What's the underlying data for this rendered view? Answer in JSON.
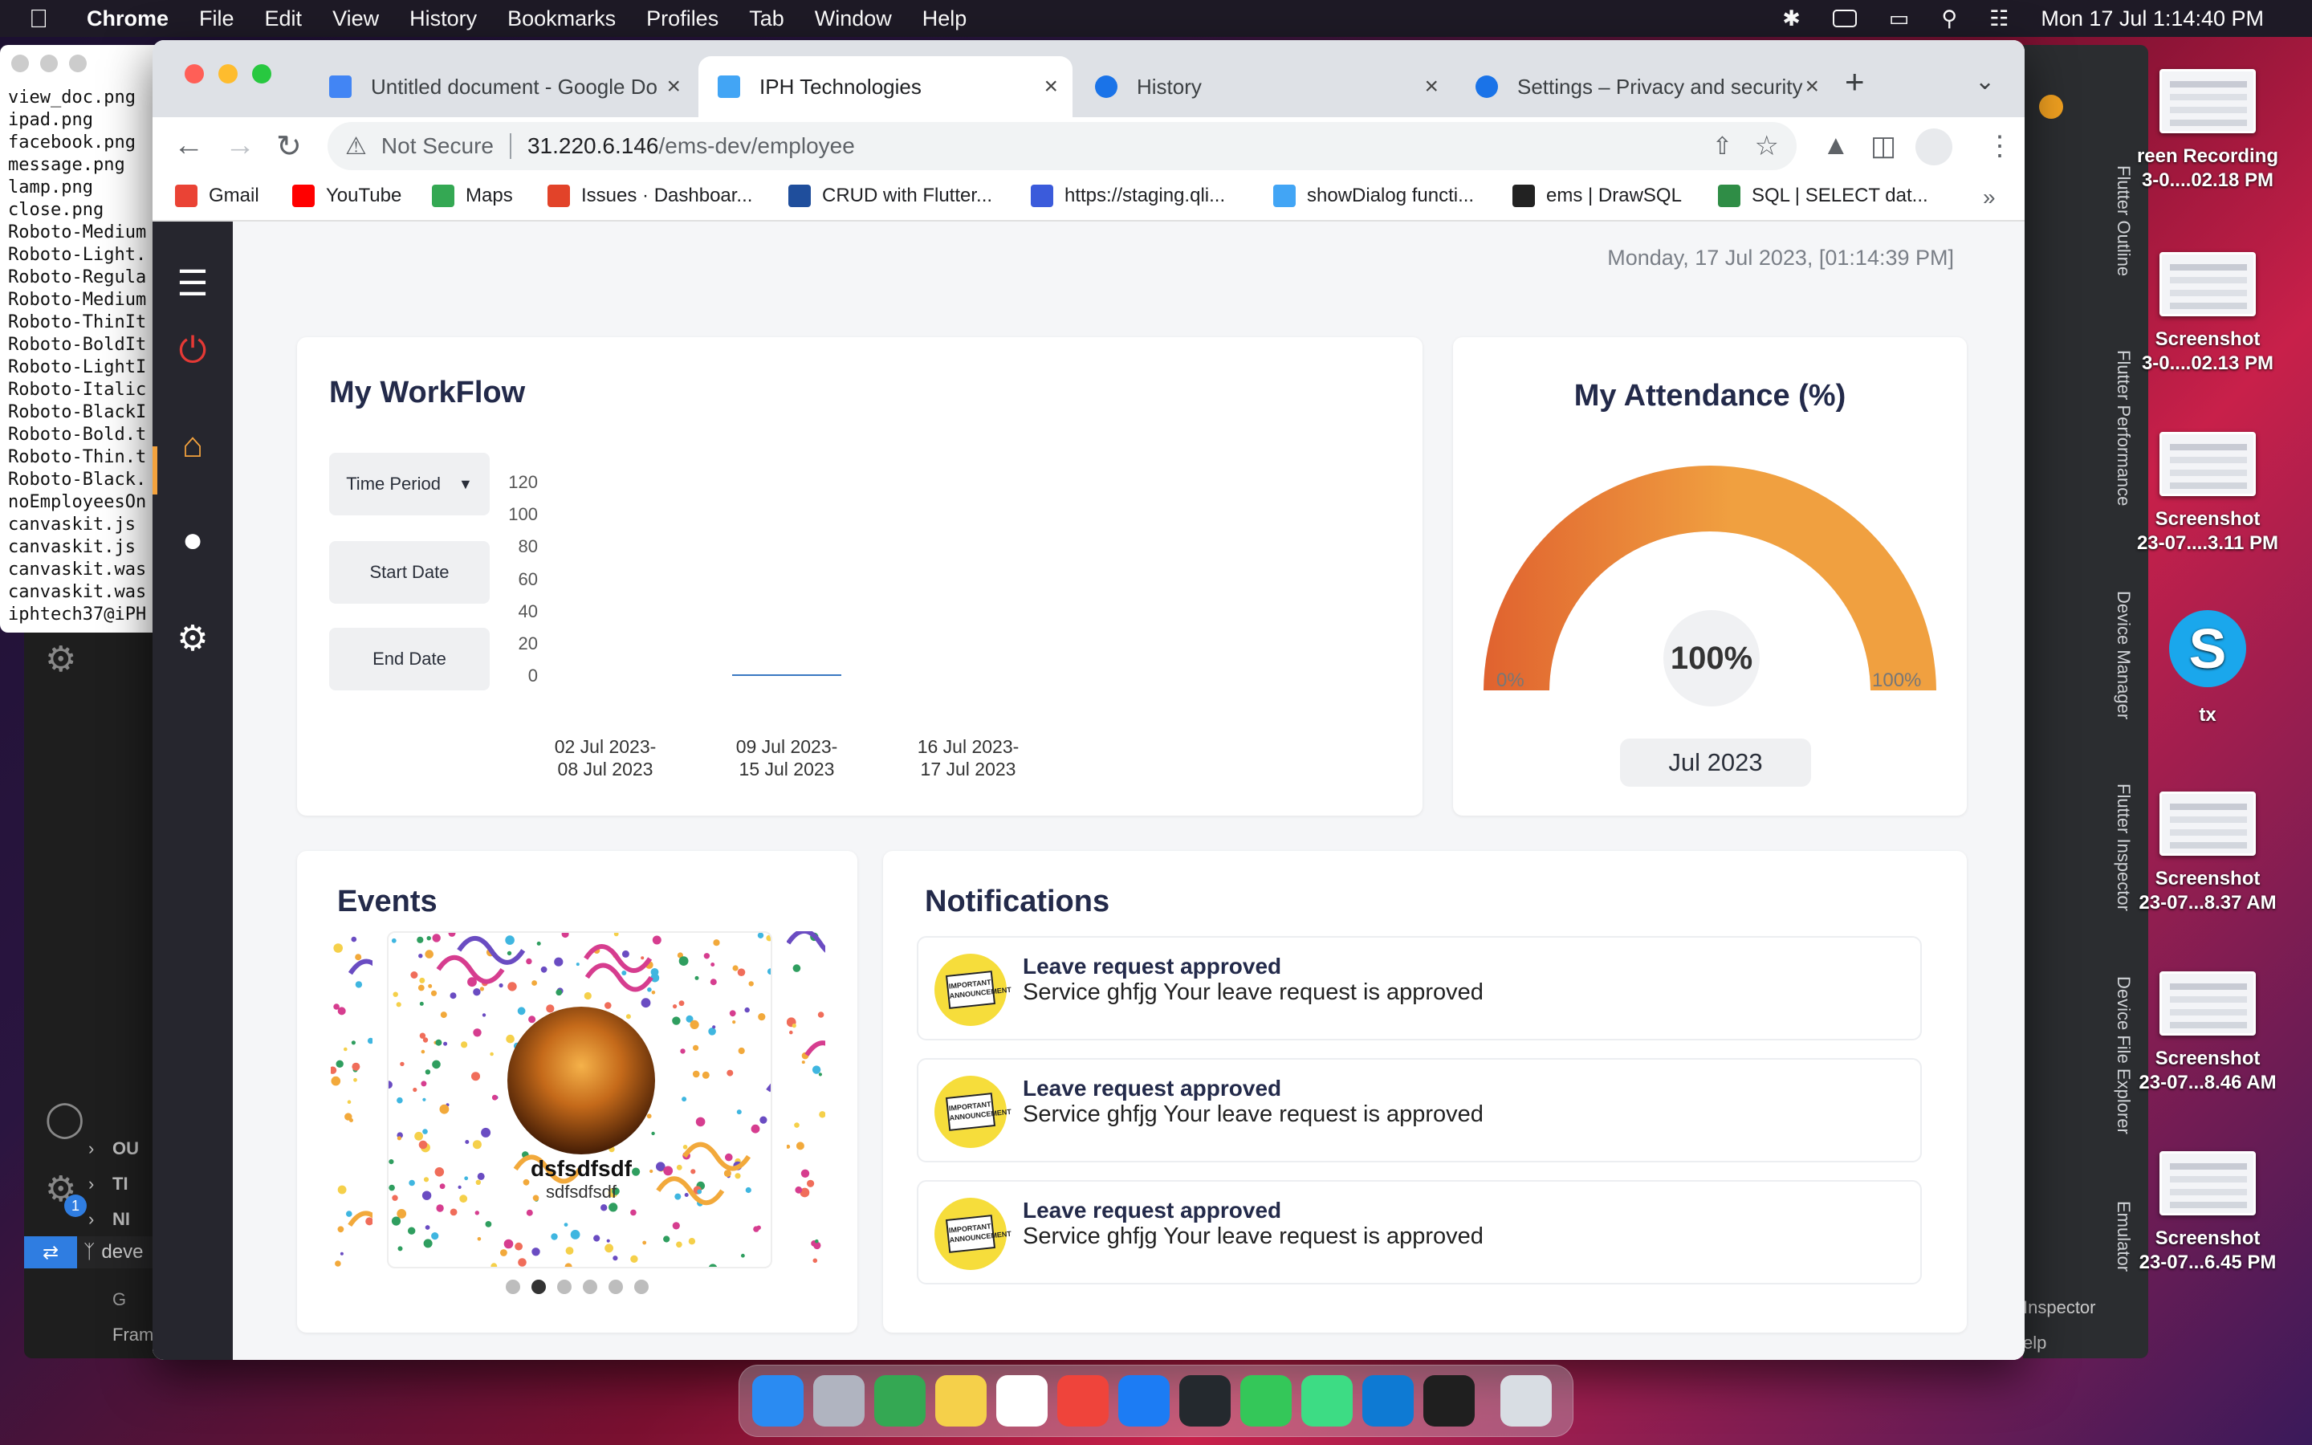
{
  "menubar": {
    "app": "Chrome",
    "items": [
      "File",
      "Edit",
      "View",
      "History",
      "Bookmarks",
      "Profiles",
      "Tab",
      "Window",
      "Help"
    ],
    "clock": "Mon 17 Jul  1:14:40 PM"
  },
  "finder_files": [
    "view_doc.png",
    "ipad.png",
    "facebook.png",
    "message.png",
    "lamp.png",
    "close.png",
    "Roboto-Medium",
    "Roboto-Light.",
    "Roboto-Regula",
    "Roboto-Medium",
    "Roboto-ThinIt",
    "Roboto-BoldIt",
    "Roboto-LightI",
    "Roboto-Italic",
    "Roboto-BlackI",
    "Roboto-Bold.t",
    "Roboto-Thin.t",
    "Roboto-Black.",
    "noEmployeesOn",
    "canvaskit.js",
    "canvaskit.js",
    "canvaskit.was",
    "canvaskit.was",
    "iphtech37@iPH"
  ],
  "vscode": {
    "labels": [
      "OU",
      "TI",
      "NI"
    ],
    "branch": "deve",
    "bottom": "Fram",
    "badge": "1",
    "bottom_prefix": "G"
  },
  "ide": {
    "panels": [
      "Flutter Outline",
      "Flutter Performance",
      "Device Manager",
      "Flutter Inspector",
      "Device File Explorer",
      "Emulator"
    ],
    "inspector": "Inspector",
    "help": "elp"
  },
  "desktop": [
    {
      "line1": "reen Recording",
      "line2": "3-0....02.18 PM"
    },
    {
      "line1": "Screenshot",
      "line2": "3-0....02.13 PM"
    },
    {
      "line1": "Screenshot",
      "line2": "23-07....3.11 PM"
    },
    {
      "line1": "tx",
      "line2": ""
    },
    {
      "line1": "Screenshot",
      "line2": "23-07...8.37 AM"
    },
    {
      "line1": "Screenshot",
      "line2": "23-07...8.46 AM"
    },
    {
      "line1": "Screenshot",
      "line2": "23-07...6.45 PM"
    }
  ],
  "skype_letter": "S",
  "tabs": [
    {
      "title": "Untitled document - Google Do",
      "color": "#4285f4"
    },
    {
      "title": "IPH Technologies",
      "color": "#42a5f5"
    },
    {
      "title": "History",
      "color": "#1a73e8"
    },
    {
      "title": "Settings – Privacy and security",
      "color": "#1a73e8"
    }
  ],
  "omnibox": {
    "security": "Not Secure",
    "host": "31.220.6.146",
    "path": "/ems-dev/employee"
  },
  "bookmarks": [
    {
      "label": "Gmail",
      "color": "#ea4335"
    },
    {
      "label": "YouTube",
      "color": "#ff0000"
    },
    {
      "label": "Maps",
      "color": "#34a853"
    },
    {
      "label": "Issues · Dashboar...",
      "color": "#e24329"
    },
    {
      "label": "CRUD with Flutter...",
      "color": "#1f4e9c"
    },
    {
      "label": "https://staging.qli...",
      "color": "#3b5bdb"
    },
    {
      "label": "showDialog functi...",
      "color": "#42a5f5"
    },
    {
      "label": "ems | DrawSQL",
      "color": "#222222"
    },
    {
      "label": "SQL | SELECT dat...",
      "color": "#2f8d46"
    }
  ],
  "app": {
    "datetime": "Monday, 17 Jul 2023, [01:14:39 PM]",
    "workflow": {
      "title": "My WorkFlow",
      "time_period": "Time Period",
      "start_date": "Start Date",
      "end_date": "End Date"
    },
    "attendance": {
      "title": "My Attendance (%)",
      "value_label": "100%",
      "min_label": "0%",
      "max_label": "100%",
      "month": "Jul 2023",
      "percent": 100
    },
    "events": {
      "title": "Events",
      "name": "dsfsdfsdf",
      "subtitle": "sdfsdfsdf",
      "dots": 6,
      "active_dot": 1
    },
    "notifications": {
      "title": "Notifications",
      "icon_text": "IMPORTANT ANNOUNCEMENT",
      "items": [
        {
          "title": "Leave request approved",
          "body": "Service ghfjg Your leave request is approved"
        },
        {
          "title": "Leave request approved",
          "body": "Service ghfjg Your leave request is approved"
        },
        {
          "title": "Leave request approved",
          "body": "Service ghfjg Your leave request is approved"
        }
      ]
    }
  },
  "chart_data": {
    "type": "line",
    "title": "",
    "xlabel": "",
    "ylabel": "",
    "categories": [
      "02 Jul 2023-\n08 Jul 2023",
      "09 Jul 2023-\n15 Jul 2023",
      "16 Jul 2023-\n17 Jul 2023"
    ],
    "yticks": [
      120,
      100,
      80,
      60,
      40,
      20,
      0
    ],
    "ylim": [
      0,
      120
    ],
    "series": [
      {
        "values": [
          0,
          0,
          0
        ],
        "color": "#3a78c2"
      }
    ],
    "visible_segment_x": [
      1,
      2
    ]
  },
  "colors": {
    "sidebar": "#26262e",
    "accent": "#f3a23d",
    "power": "#e53935",
    "title": "#232a4a",
    "gauge_start": "#e0622f",
    "gauge_end": "#f0a040"
  },
  "dock_apps": [
    {
      "name": "finder",
      "color": "#2a8bf2"
    },
    {
      "name": "launchpad",
      "color": "#b0b4c0"
    },
    {
      "name": "chrome",
      "color": "#34a853"
    },
    {
      "name": "notes",
      "color": "#f5d04a"
    },
    {
      "name": "freeform",
      "color": "#ffffff"
    },
    {
      "name": "anydesk",
      "color": "#ef443b"
    },
    {
      "name": "xcode",
      "color": "#1c7cf4"
    },
    {
      "name": "github",
      "color": "#24292e"
    },
    {
      "name": "messages",
      "color": "#34c759"
    },
    {
      "name": "android-studio",
      "color": "#3ddc84"
    },
    {
      "name": "vscode",
      "color": "#0e7ad3"
    },
    {
      "name": "terminal",
      "color": "#1f1f1f"
    },
    {
      "name": "trash",
      "color": "#d8dde3"
    }
  ]
}
